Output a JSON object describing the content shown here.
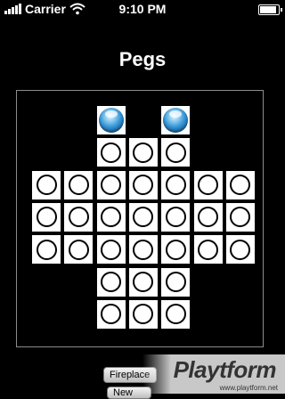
{
  "status_bar": {
    "carrier": "Carrier",
    "time": "9:10 PM",
    "battery_level": 1.0
  },
  "title": "Pegs",
  "board": {
    "rows": [
      [
        "empty",
        "empty",
        "peg",
        "empty",
        "peg",
        "empty",
        "empty"
      ],
      [
        "empty",
        "empty",
        "hole",
        "hole",
        "hole",
        "empty",
        "empty"
      ],
      [
        "hole",
        "hole",
        "hole",
        "hole",
        "hole",
        "hole",
        "hole"
      ],
      [
        "hole",
        "hole",
        "hole",
        "hole",
        "hole",
        "hole",
        "hole"
      ],
      [
        "hole",
        "hole",
        "hole",
        "hole",
        "hole",
        "hole",
        "hole"
      ],
      [
        "empty",
        "empty",
        "hole",
        "hole",
        "hole",
        "empty",
        "empty"
      ],
      [
        "empty",
        "empty",
        "hole",
        "hole",
        "hole",
        "empty",
        "empty"
      ]
    ],
    "peg_color": "#3a98d8"
  },
  "buttons": {
    "fireplace": "Fireplace",
    "new": "New"
  },
  "watermark": {
    "logo": "Playtform",
    "url": "www.playtform.net"
  }
}
